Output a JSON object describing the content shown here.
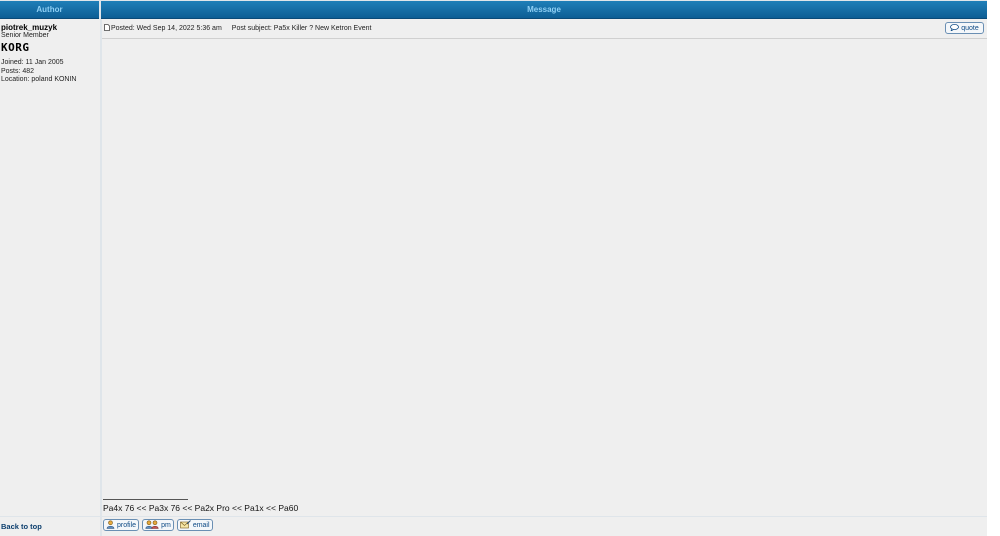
{
  "header": {
    "author_col": "Author",
    "message_col": "Message"
  },
  "author": {
    "username": "piotrek_muzyk",
    "rank": "Senior Member",
    "rank_image_text": "KORG",
    "joined": "Joined: 11 Jan 2005",
    "posts": "Posts: 482",
    "location": "Location: poland KONIN"
  },
  "post": {
    "icon": "post-icon",
    "posted": "Posted: Wed Sep 14, 2022 5:36 am",
    "subject": "Post subject: Pa5x Killer ? New Ketron Event",
    "quote_label": "quote",
    "signature": "Pa4x 76 << Pa3x 76 << Pa2x Pro << Pa1x << Pa60"
  },
  "footer": {
    "back_to_top": "Back to top",
    "buttons": {
      "profile": "profile",
      "pm": "pm",
      "email": "email"
    }
  },
  "colors": {
    "header_bg": "#1669a3",
    "header_text": "#8fd0f5",
    "cell_bg": "#efefef",
    "link": "#0d3f6e"
  }
}
